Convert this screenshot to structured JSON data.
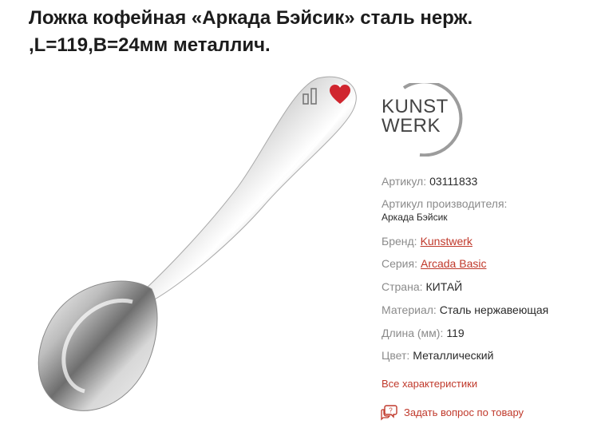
{
  "product": {
    "title_line1": "Ложка кофейная «Аркада Бэйсик» сталь нерж.",
    "title_line2": ",L=119,B=24мм металлич."
  },
  "icons": {
    "compare": "compare-bars-icon",
    "favorite": "heart-icon",
    "ask": "chat-question-icon"
  },
  "colors": {
    "accent": "#c0392b",
    "heart": "#d0262f",
    "label_gray": "#8b8b8b"
  },
  "brand_logo": {
    "line1": "KUNST",
    "line2": "WERK"
  },
  "specs": {
    "article_label": "Артикул:",
    "article_value": "03111833",
    "mfr_article_label": "Артикул производителя:",
    "mfr_article_value": "Аркада Бэйсик",
    "brand_label": "Бренд:",
    "brand_value": "Kunstwerk",
    "series_label": "Серия:",
    "series_value": "Arcada Basic",
    "country_label": "Страна:",
    "country_value": "КИТАЙ",
    "material_label": "Материал:",
    "material_value": "Сталь нержавеющая",
    "length_label": "Длина (мм):",
    "length_value": "119",
    "color_label": "Цвет:",
    "color_value": "Металлический"
  },
  "links": {
    "all_characteristics": "Все характеристики",
    "ask_question": "Задать вопрос по товару"
  }
}
